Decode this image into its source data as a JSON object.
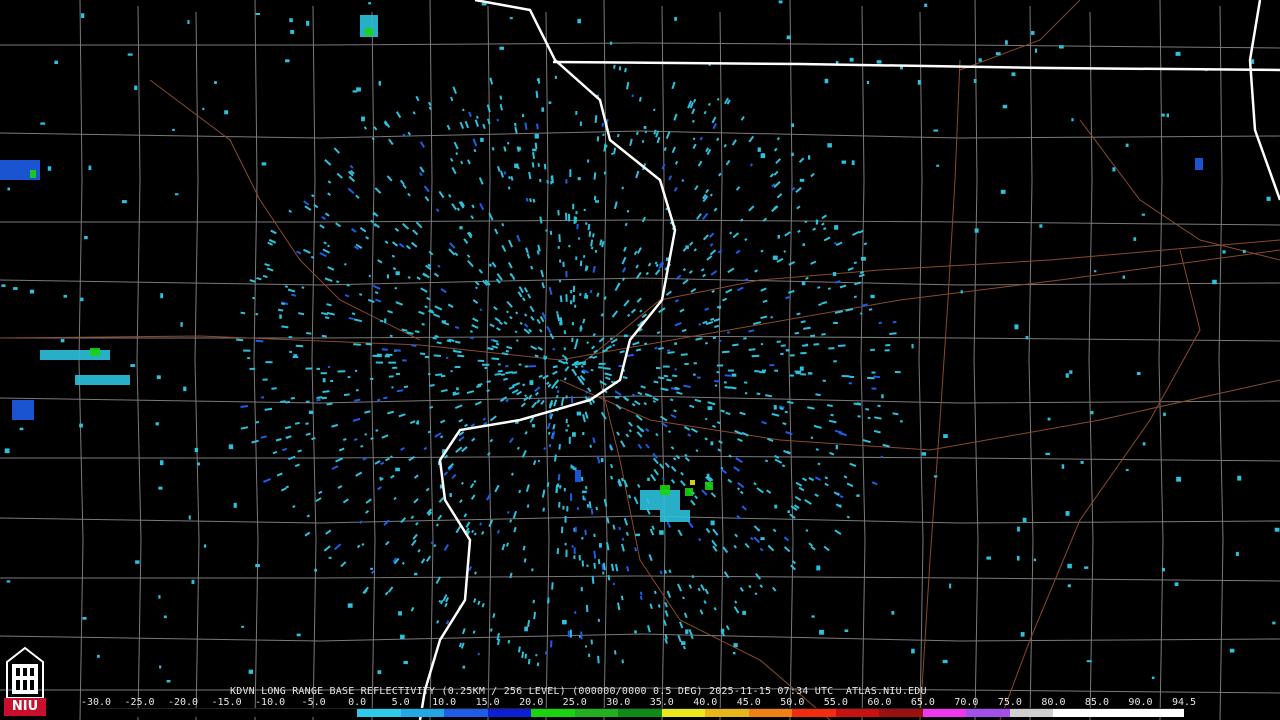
{
  "product": {
    "caption": "KDVN LONG RANGE BASE REFLECTIVITY (0.25KM / 256 LEVEL) (000000/0000 0.5 DEG) 2025-11-15 07:34 UTC  ATLAS.NIU.EDU"
  },
  "colorbar": {
    "labels": [
      "-30.0",
      "-25.0",
      "-20.0",
      "-15.0",
      "-10.0",
      "-5.0",
      "0.0",
      "5.0",
      "10.0",
      "15.0",
      "20.0",
      "25.0",
      "30.0",
      "35.0",
      "40.0",
      "45.0",
      "50.0",
      "55.0",
      "60.0",
      "65.0",
      "70.0",
      "75.0",
      "80.0",
      "85.0",
      "90.0",
      "94.5"
    ],
    "colors": [
      "#000000",
      "#000000",
      "#000000",
      "#000000",
      "#000000",
      "#000000",
      "#2fc9ea",
      "#22a6e4",
      "#1e5de8",
      "#0c1ed6",
      "#19d40e",
      "#22b021",
      "#0f8a17",
      "#e8e81d",
      "#e8b51a",
      "#f07f16",
      "#f32b0f",
      "#c81212",
      "#9c1012",
      "#ee38ee",
      "#a54fea",
      "#d0d0d0",
      "#ffffff",
      "#ffffff",
      "#ffffff"
    ]
  },
  "logo": {
    "text": "NIU"
  },
  "map_style": {
    "state_border": "#ffffff",
    "county_line": "#7a7a7a",
    "road": "#8a4a2c",
    "echo_light": "#2cc1dc",
    "echo_mid": "#1e5de8",
    "echo_green": "#19d40e",
    "echo_yellow": "#e8e81d"
  }
}
